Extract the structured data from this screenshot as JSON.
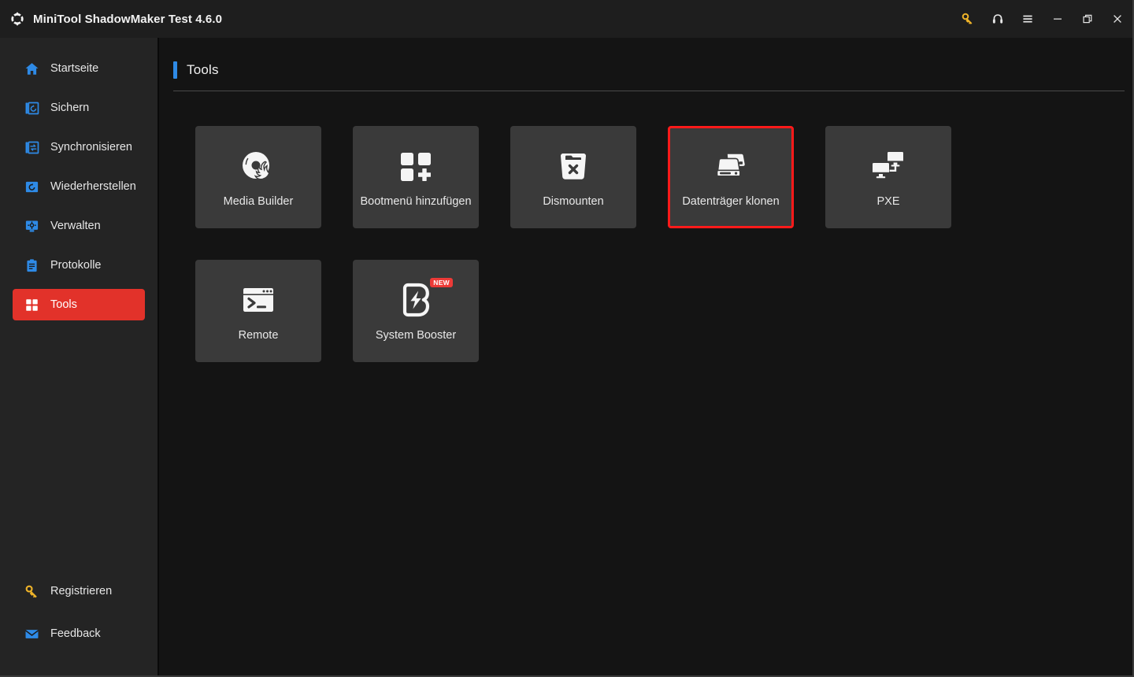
{
  "window": {
    "title": "MiniTool ShadowMaker Test 4.6.0",
    "logo_icon": "refresh-arrows-icon",
    "controls": [
      {
        "name": "license-key-button",
        "icon": "key-icon",
        "color": "#f0b429"
      },
      {
        "name": "support-button",
        "icon": "headset-icon",
        "color": "#e8e8e8"
      },
      {
        "name": "menu-button",
        "icon": "hamburger-menu-icon",
        "color": "#e8e8e8"
      },
      {
        "name": "minimize-button",
        "icon": "minimize-icon",
        "color": "#e8e8e8"
      },
      {
        "name": "restore-button",
        "icon": "restore-icon",
        "color": "#e8e8e8"
      },
      {
        "name": "close-button",
        "icon": "close-icon",
        "color": "#e8e8e8"
      }
    ]
  },
  "sidebar": {
    "accent_active_color": "#e2322a",
    "items": [
      {
        "label": "Startseite",
        "icon": "home-icon",
        "active": false
      },
      {
        "label": "Sichern",
        "icon": "backup-icon",
        "active": false
      },
      {
        "label": "Synchronisieren",
        "icon": "sync-icon",
        "active": false
      },
      {
        "label": "Wiederherstellen",
        "icon": "restore-disk-icon",
        "active": false
      },
      {
        "label": "Verwalten",
        "icon": "manage-gear-icon",
        "active": false
      },
      {
        "label": "Protokolle",
        "icon": "logs-icon",
        "active": false
      },
      {
        "label": "Tools",
        "icon": "tools-grid-icon",
        "active": true
      }
    ],
    "bottom_items": [
      {
        "label": "Registrieren",
        "icon": "key-icon",
        "color": "#f0b429"
      },
      {
        "label": "Feedback",
        "icon": "envelope-icon",
        "color": "#2e8ae6"
      }
    ]
  },
  "main": {
    "page_title": "Tools",
    "accent_color": "#2e8ae6",
    "tools": [
      {
        "label": "Media Builder",
        "icon": "disc-flame-icon",
        "highlighted": false,
        "badge": null
      },
      {
        "label": "Bootmenü hinzufügen",
        "icon": "add-boot-menu-icon",
        "highlighted": false,
        "badge": null
      },
      {
        "label": "Dismounten",
        "icon": "dismount-bin-icon",
        "highlighted": false,
        "badge": null
      },
      {
        "label": "Datenträger klonen",
        "icon": "clone-disk-icon",
        "highlighted": true,
        "badge": null
      },
      {
        "label": "PXE",
        "icon": "pxe-network-icon",
        "highlighted": false,
        "badge": null
      },
      {
        "label": "Remote",
        "icon": "terminal-icon",
        "highlighted": false,
        "badge": null
      },
      {
        "label": "System Booster",
        "icon": "booster-bolt-icon",
        "highlighted": false,
        "badge": "NEW"
      }
    ],
    "highlight_color": "#ff1a1a"
  }
}
